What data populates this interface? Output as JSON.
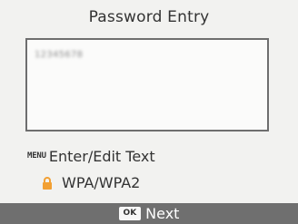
{
  "screen": {
    "title": "Password Entry",
    "password_field": {
      "value": "12345678"
    },
    "menu_hint": {
      "key_label": "MENU",
      "text": "Enter/Edit Text"
    },
    "security": {
      "icon": "lock-icon",
      "icon_color": "#f2a033",
      "text": "WPA/WPA2"
    },
    "footer": {
      "key_label": "OK",
      "text": "Next",
      "background": "#6f6f6f"
    }
  }
}
